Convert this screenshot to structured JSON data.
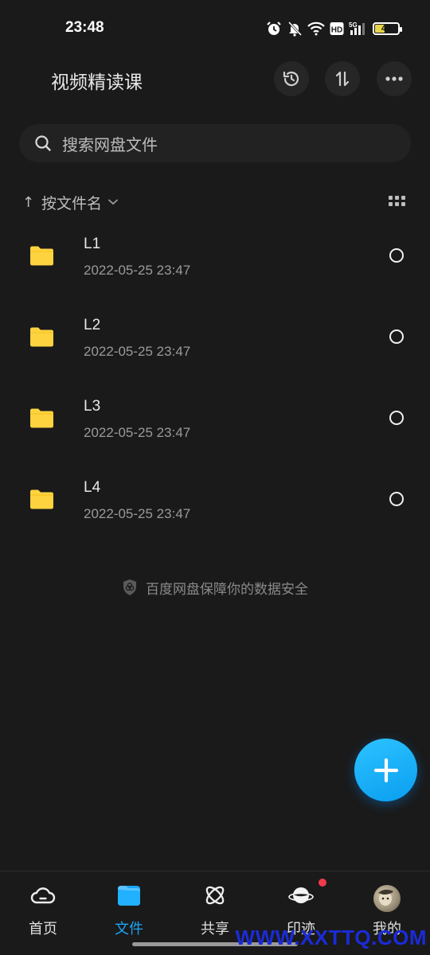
{
  "status_bar": {
    "time": "23:48",
    "battery_level": "40",
    "network": "5G",
    "hd_badge": "HD"
  },
  "header": {
    "title": "视频精读课"
  },
  "search": {
    "placeholder": "搜索网盘文件"
  },
  "sort": {
    "arrow": "↑",
    "label": "按文件名"
  },
  "files": [
    {
      "name": "L1",
      "date": "2022-05-25  23:47"
    },
    {
      "name": "L2",
      "date": "2022-05-25  23:47"
    },
    {
      "name": "L3",
      "date": "2022-05-25  23:47"
    },
    {
      "name": "L4",
      "date": "2022-05-25  23:47"
    }
  ],
  "security_notice": "百度网盘保障你的数据安全",
  "bottom_nav": [
    {
      "label": "首页",
      "icon": "cloud-home-icon"
    },
    {
      "label": "文件",
      "icon": "folder-icon",
      "active": true
    },
    {
      "label": "共享",
      "icon": "atom-share-icon"
    },
    {
      "label": "印迹",
      "icon": "planet-icon"
    },
    {
      "label": "我的",
      "icon": "avatar"
    }
  ],
  "watermark": "WWW.XXTTQ.COM",
  "colors": {
    "accent": "#1aa5f5",
    "folder": "#fdd33f",
    "background": "#1a1a1a",
    "badge": "#f23a4b"
  }
}
